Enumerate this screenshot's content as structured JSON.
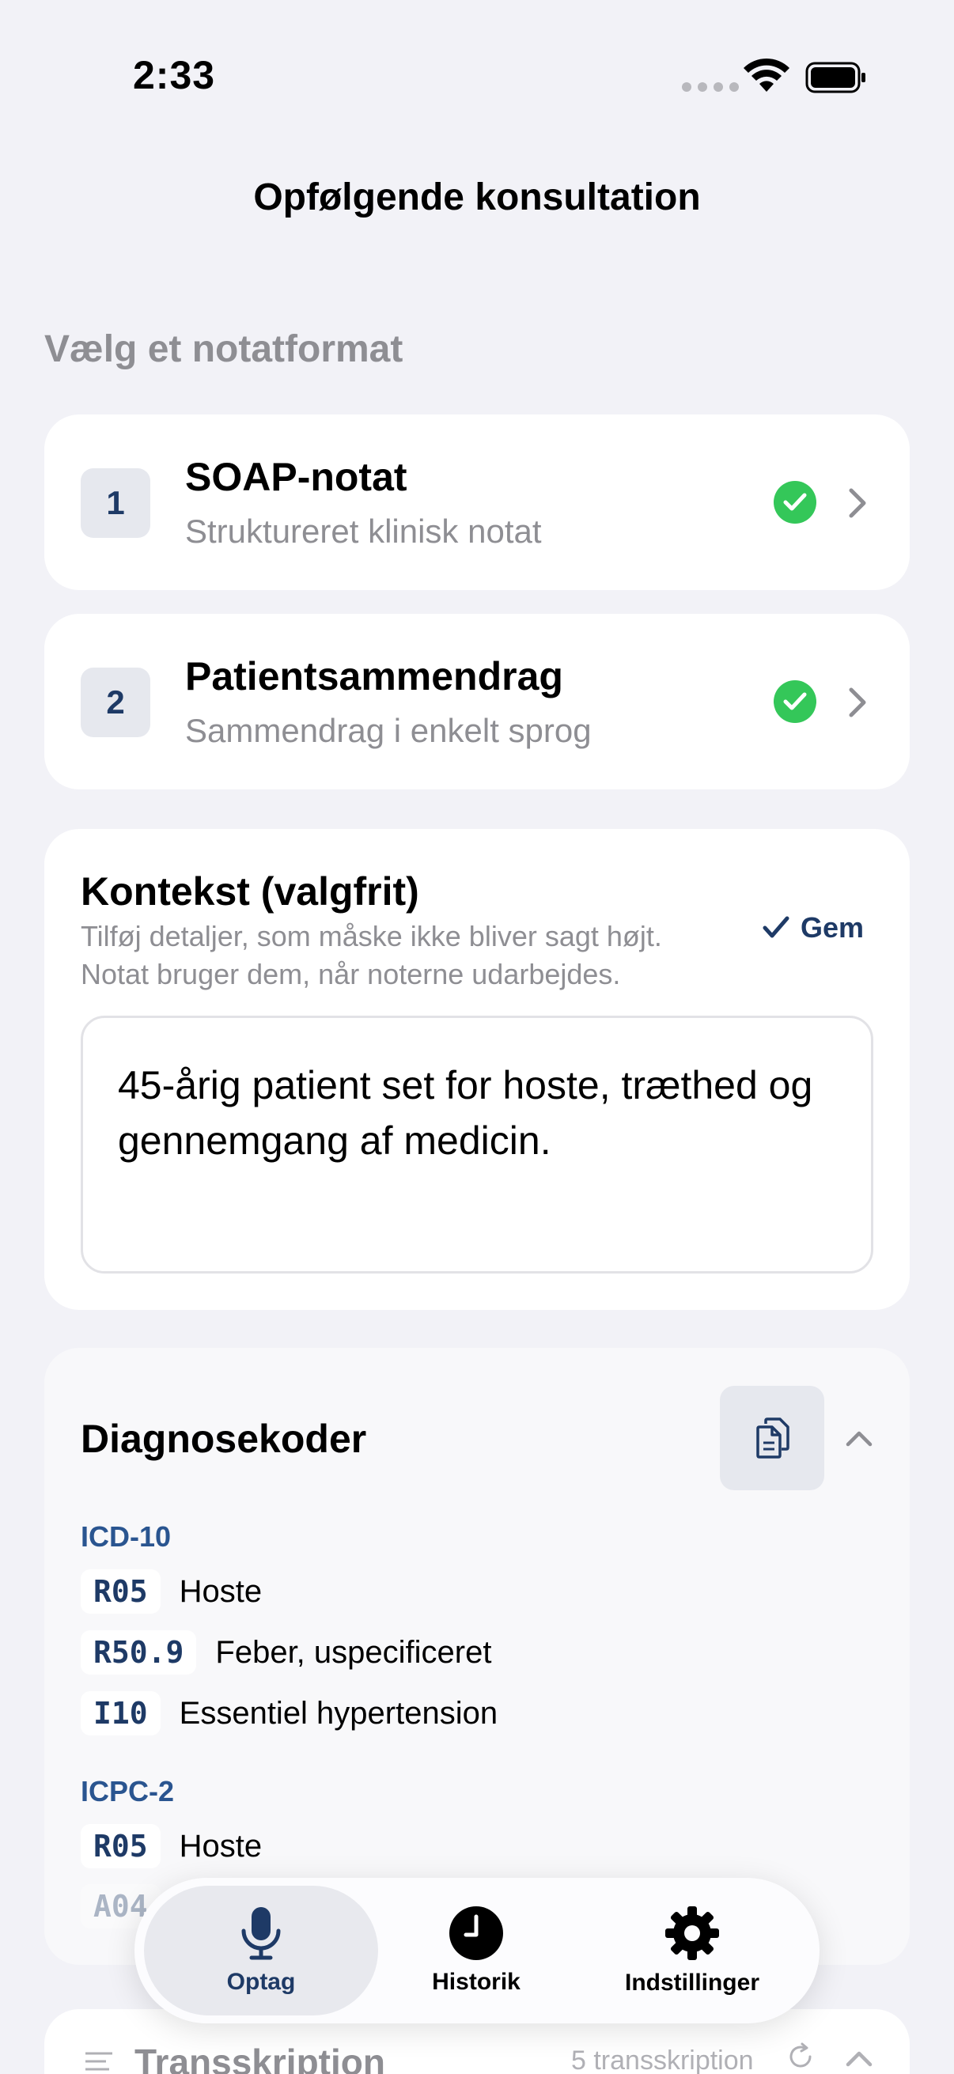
{
  "status_bar": {
    "time": "2:33"
  },
  "nav": {
    "title": "Opfølgende konsultation"
  },
  "format_section": {
    "header": "Vælg et notatformat",
    "items": [
      {
        "number": "1",
        "title": "SOAP-notat",
        "subtitle": "Struktureret klinisk notat",
        "selected": true
      },
      {
        "number": "2",
        "title": "Patientsammendrag",
        "subtitle": "Sammendrag i enkelt sprog",
        "selected": true
      }
    ]
  },
  "context": {
    "title": "Kontekst (valgfrit)",
    "description": "Tilføj detaljer, som måske ikke bliver sagt højt. Notat bruger dem, når noterne udarbejdes.",
    "save_label": "Gem",
    "value": "45-årig patient set for hoste, træthed og gennemgang af medicin."
  },
  "diagnoses": {
    "title": "Diagnosekoder",
    "systems": [
      {
        "label": "ICD-10",
        "codes": [
          {
            "code": "R05",
            "desc": "Hoste"
          },
          {
            "code": "R50.9",
            "desc": "Feber, uspecificeret"
          },
          {
            "code": "I10",
            "desc": "Essentiel hypertension"
          }
        ]
      },
      {
        "label": "ICPC-2",
        "codes": [
          {
            "code": "R05",
            "desc": "Hoste"
          },
          {
            "code": "A04",
            "desc": ""
          }
        ]
      }
    ]
  },
  "transcription": {
    "title": "Transskription",
    "count": "5 transskription"
  },
  "tabbar": {
    "tabs": [
      {
        "label": "Optag",
        "icon": "mic-icon",
        "active": true
      },
      {
        "label": "Historik",
        "icon": "clock-icon",
        "active": false
      },
      {
        "label": "Indstillinger",
        "icon": "gear-icon",
        "active": false
      }
    ]
  },
  "colors": {
    "accent": "#1e3a66",
    "success": "#34c759",
    "background": "#f2f2f7"
  }
}
